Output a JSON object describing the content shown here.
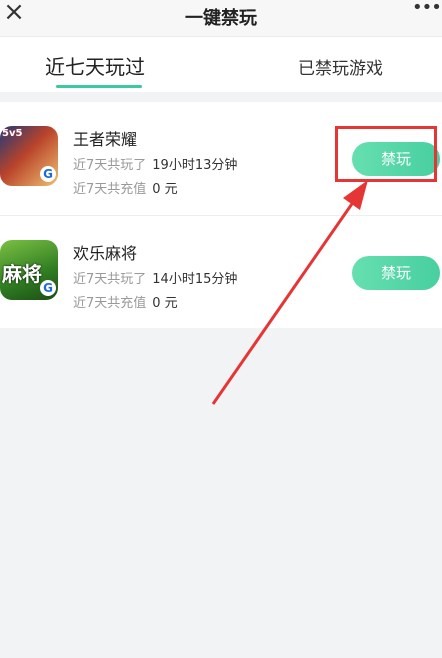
{
  "header": {
    "title": "一键禁玩",
    "close_icon": "close-icon",
    "more_icon": "more-icon"
  },
  "tabs": [
    {
      "label": "近七天玩过",
      "active": true
    },
    {
      "label": "已禁玩游戏",
      "active": false
    }
  ],
  "apps": [
    {
      "name": "王者荣耀",
      "icon": "game-icon-king-of-glory",
      "play_label": "近7天共玩了",
      "play_value": "19小时13分钟",
      "recharge_label": "近7天共充值",
      "recharge_value": "0 元",
      "button_label": "禁玩"
    },
    {
      "name": "欢乐麻将",
      "icon": "game-icon-happy-mahjong",
      "play_label": "近7天共玩了",
      "play_value": "14小时15分钟",
      "recharge_label": "近7天共充值",
      "recharge_value": "0 元",
      "button_label": "禁玩"
    }
  ],
  "colors": {
    "accent": "#48cfa0",
    "annotation": "#e53535"
  }
}
